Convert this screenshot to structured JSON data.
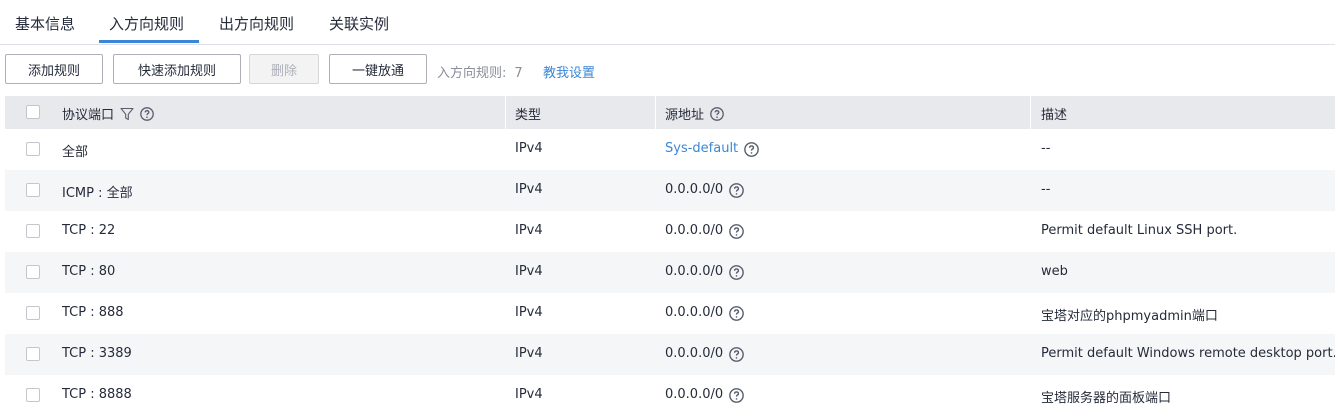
{
  "tabs": [
    {
      "label": "基本信息"
    },
    {
      "label": "入方向规则"
    },
    {
      "label": "出方向规则"
    },
    {
      "label": "关联实例"
    }
  ],
  "toolbar": {
    "add_rule": "添加规则",
    "quick_add_rule": "快速添加规则",
    "delete": "删除",
    "one_click_open": "一键放通",
    "rule_count_label": "入方向规则:",
    "rule_count_value": "7",
    "help_link": "教我设置"
  },
  "table": {
    "headers": {
      "protocol_port": "协议端口",
      "type": "类型",
      "source": "源地址",
      "description": "描述"
    },
    "rows": [
      {
        "protocol_port": "全部",
        "type": "IPv4",
        "source": "Sys-default",
        "source_is_link": true,
        "description": "--"
      },
      {
        "protocol_port": "ICMP : 全部",
        "type": "IPv4",
        "source": "0.0.0.0/0",
        "description": "--"
      },
      {
        "protocol_port": "TCP : 22",
        "type": "IPv4",
        "source": "0.0.0.0/0",
        "description": "Permit default Linux SSH port."
      },
      {
        "protocol_port": "TCP : 80",
        "type": "IPv4",
        "source": "0.0.0.0/0",
        "description": "web"
      },
      {
        "protocol_port": "TCP : 888",
        "type": "IPv4",
        "source": "0.0.0.0/0",
        "description": "宝塔对应的phpmyadmin端口"
      },
      {
        "protocol_port": "TCP : 3389",
        "type": "IPv4",
        "source": "0.0.0.0/0",
        "description": "Permit default Windows remote desktop port."
      },
      {
        "protocol_port": "TCP : 8888",
        "type": "IPv4",
        "source": "0.0.0.0/0",
        "description": "宝塔服务器的面板端口"
      }
    ]
  },
  "colors": {
    "accent": "#3b87d5",
    "header_bg": "#e8e9ec",
    "row_alt_bg": "#f5f6f8"
  },
  "icons": {
    "filter": "filter-icon",
    "help": "question-circle-icon"
  }
}
